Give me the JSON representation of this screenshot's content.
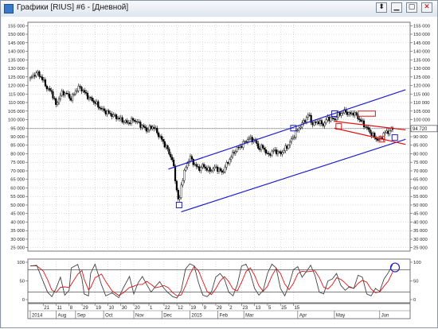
{
  "window": {
    "title": "Графики [RIUS] #6 - [Дневной]"
  },
  "titlebar_buttons": [
    {
      "name": "pin-button",
      "glyph": "⬍"
    },
    {
      "name": "minimize-button",
      "glyph": "▁"
    },
    {
      "name": "maximize-button",
      "glyph": "▢"
    },
    {
      "name": "close-button",
      "glyph": "✕"
    }
  ],
  "colors": {
    "candles": "#000000",
    "channel": "#1f1fcc",
    "channel_red": "#e01414",
    "osc_main": "#444444",
    "osc_signal": "#e01414",
    "grid": "#b8b8b8",
    "marker_blue": "#1f1fcc",
    "marker_red": "#e01414"
  },
  "chart_data": [
    {
      "type": "candlestick",
      "y_ticks": [
        25000,
        30000,
        35000,
        40000,
        45000,
        50000,
        55000,
        60000,
        65000,
        70000,
        75000,
        80000,
        85000,
        90000,
        95000,
        100000,
        105000,
        110000,
        115000,
        120000,
        125000,
        130000,
        135000,
        140000,
        145000,
        150000,
        155000
      ],
      "y_tick_labels": [
        "25 000",
        "30 000",
        "35 000",
        "40 000",
        "45 000",
        "50 000",
        "55 000",
        "60 000",
        "65 000",
        "70 000",
        "75 000",
        "80 000",
        "85 000",
        "90 000",
        "95 000",
        "100 000",
        "105 000",
        "110 000",
        "115 000",
        "120 000",
        "125 000",
        "130 000",
        "135 000",
        "140 000",
        "145 000",
        "150 000",
        "155 000"
      ],
      "ylim": [
        23000,
        157000
      ],
      "last_price_label": "94 720",
      "last_price": 94720,
      "close_path": [
        {
          "t": 0,
          "c": 124000
        },
        {
          "t": 3,
          "c": 127500
        },
        {
          "t": 5,
          "c": 125000
        },
        {
          "t": 8,
          "c": 118000
        },
        {
          "t": 10,
          "c": 116000
        },
        {
          "t": 12,
          "c": 108000
        },
        {
          "t": 13,
          "c": 112000
        },
        {
          "t": 15,
          "c": 116000
        },
        {
          "t": 17,
          "c": 115000
        },
        {
          "t": 19,
          "c": 112000
        },
        {
          "t": 21,
          "c": 117000
        },
        {
          "t": 23,
          "c": 119000
        },
        {
          "t": 25,
          "c": 116000
        },
        {
          "t": 27,
          "c": 113000
        },
        {
          "t": 30,
          "c": 110000
        },
        {
          "t": 33,
          "c": 106000
        },
        {
          "t": 36,
          "c": 104000
        },
        {
          "t": 39,
          "c": 102000
        },
        {
          "t": 42,
          "c": 100000
        },
        {
          "t": 45,
          "c": 98000
        },
        {
          "t": 48,
          "c": 100000
        },
        {
          "t": 51,
          "c": 97000
        },
        {
          "t": 54,
          "c": 94000
        },
        {
          "t": 57,
          "c": 96000
        },
        {
          "t": 60,
          "c": 90000
        },
        {
          "t": 63,
          "c": 84000
        },
        {
          "t": 66,
          "c": 76000
        },
        {
          "t": 68,
          "c": 58000
        },
        {
          "t": 69,
          "c": 50000
        },
        {
          "t": 70,
          "c": 62000
        },
        {
          "t": 72,
          "c": 72000
        },
        {
          "t": 74,
          "c": 78000
        },
        {
          "t": 76,
          "c": 74000
        },
        {
          "t": 78,
          "c": 71000
        },
        {
          "t": 80,
          "c": 73000
        },
        {
          "t": 83,
          "c": 70000
        },
        {
          "t": 86,
          "c": 72000
        },
        {
          "t": 89,
          "c": 69000
        },
        {
          "t": 92,
          "c": 76000
        },
        {
          "t": 95,
          "c": 82000
        },
        {
          "t": 98,
          "c": 85000
        },
        {
          "t": 101,
          "c": 89000
        },
        {
          "t": 104,
          "c": 88000
        },
        {
          "t": 106,
          "c": 83000
        },
        {
          "t": 108,
          "c": 84000
        },
        {
          "t": 110,
          "c": 79000
        },
        {
          "t": 113,
          "c": 82000
        },
        {
          "t": 116,
          "c": 80000
        },
        {
          "t": 119,
          "c": 84000
        },
        {
          "t": 121,
          "c": 88000
        },
        {
          "t": 123,
          "c": 92000
        },
        {
          "t": 125,
          "c": 96000
        },
        {
          "t": 127,
          "c": 99000
        },
        {
          "t": 129,
          "c": 103000
        },
        {
          "t": 131,
          "c": 97000
        },
        {
          "t": 133,
          "c": 99000
        },
        {
          "t": 136,
          "c": 97000
        },
        {
          "t": 138,
          "c": 101000
        },
        {
          "t": 141,
          "c": 100000
        },
        {
          "t": 143,
          "c": 103000
        },
        {
          "t": 146,
          "c": 105000
        },
        {
          "t": 148,
          "c": 103000
        },
        {
          "t": 150,
          "c": 104000
        },
        {
          "t": 152,
          "c": 101000
        },
        {
          "t": 154,
          "c": 98000
        },
        {
          "t": 156,
          "c": 95000
        },
        {
          "t": 158,
          "c": 92000
        },
        {
          "t": 160,
          "c": 89000
        },
        {
          "t": 162,
          "c": 88000
        },
        {
          "t": 164,
          "c": 92000
        },
        {
          "t": 166,
          "c": 93000
        },
        {
          "t": 168,
          "c": 94720
        }
      ],
      "channel_lines": [
        {
          "color": "blue",
          "from": {
            "t": 64,
            "v": 71000
          },
          "to": {
            "t": 174,
            "v": 117500
          }
        },
        {
          "color": "blue",
          "from": {
            "t": 70,
            "v": 46000
          },
          "to": {
            "t": 174,
            "v": 88500
          }
        },
        {
          "color": "red",
          "from": {
            "t": 141,
            "v": 99000
          },
          "to": {
            "t": 174,
            "v": 94000
          }
        },
        {
          "color": "red",
          "from": {
            "t": 141,
            "v": 95000
          },
          "to": {
            "t": 174,
            "v": 85500
          }
        }
      ],
      "markers": [
        {
          "color": "blue",
          "t": 69,
          "v": 50000
        },
        {
          "color": "blue",
          "t": 122,
          "v": 95000
        },
        {
          "color": "blue",
          "t": 141,
          "v": 103500
        },
        {
          "color": "blue",
          "t": 169,
          "v": 89500
        },
        {
          "color": "red",
          "t": 143,
          "v": 96000
        },
        {
          "color": "red",
          "t": 163,
          "v": 88500
        }
      ],
      "red_rect": {
        "t1": 152,
        "t2": 160,
        "v1": 105000,
        "v2": 102000
      }
    },
    {
      "type": "line",
      "name": "oscillator",
      "ylim": [
        0,
        100
      ],
      "y_ticks": [
        0,
        50,
        100
      ],
      "y_tick_labels": [
        "0",
        "50",
        "100"
      ],
      "reference_lines": [
        20,
        80
      ],
      "main": [
        {
          "t": 0,
          "v": 90
        },
        {
          "t": 3,
          "v": 92
        },
        {
          "t": 6,
          "v": 48
        },
        {
          "t": 8,
          "v": 20
        },
        {
          "t": 10,
          "v": 8
        },
        {
          "t": 12,
          "v": 30
        },
        {
          "t": 14,
          "v": 60
        },
        {
          "t": 16,
          "v": 12
        },
        {
          "t": 18,
          "v": 25
        },
        {
          "t": 19,
          "v": 85
        },
        {
          "t": 22,
          "v": 94
        },
        {
          "t": 24,
          "v": 55
        },
        {
          "t": 25,
          "v": 15
        },
        {
          "t": 27,
          "v": 10
        },
        {
          "t": 28,
          "v": 70
        },
        {
          "t": 30,
          "v": 95
        },
        {
          "t": 33,
          "v": 40
        },
        {
          "t": 35,
          "v": 10
        },
        {
          "t": 38,
          "v": 18
        },
        {
          "t": 41,
          "v": 5
        },
        {
          "t": 43,
          "v": 30
        },
        {
          "t": 46,
          "v": 62
        },
        {
          "t": 48,
          "v": 15
        },
        {
          "t": 50,
          "v": 45
        },
        {
          "t": 52,
          "v": 62
        },
        {
          "t": 54,
          "v": 40
        },
        {
          "t": 56,
          "v": 20
        },
        {
          "t": 58,
          "v": 35
        },
        {
          "t": 60,
          "v": 48
        },
        {
          "t": 62,
          "v": 30
        },
        {
          "t": 64,
          "v": 18
        },
        {
          "t": 66,
          "v": 8
        },
        {
          "t": 68,
          "v": 4
        },
        {
          "t": 70,
          "v": 25
        },
        {
          "t": 72,
          "v": 82
        },
        {
          "t": 74,
          "v": 96
        },
        {
          "t": 76,
          "v": 90
        },
        {
          "t": 78,
          "v": 45
        },
        {
          "t": 80,
          "v": 12
        },
        {
          "t": 82,
          "v": 8
        },
        {
          "t": 84,
          "v": 20
        },
        {
          "t": 86,
          "v": 60
        },
        {
          "t": 88,
          "v": 70
        },
        {
          "t": 90,
          "v": 55
        },
        {
          "t": 92,
          "v": 20
        },
        {
          "t": 94,
          "v": 10
        },
        {
          "t": 96,
          "v": 40
        },
        {
          "t": 98,
          "v": 90
        },
        {
          "t": 100,
          "v": 95
        },
        {
          "t": 102,
          "v": 70
        },
        {
          "t": 104,
          "v": 30
        },
        {
          "t": 106,
          "v": 12
        },
        {
          "t": 108,
          "v": 25
        },
        {
          "t": 110,
          "v": 70
        },
        {
          "t": 112,
          "v": 95
        },
        {
          "t": 114,
          "v": 85
        },
        {
          "t": 116,
          "v": 30
        },
        {
          "t": 118,
          "v": 10
        },
        {
          "t": 120,
          "v": 40
        },
        {
          "t": 122,
          "v": 80
        },
        {
          "t": 124,
          "v": 88
        },
        {
          "t": 126,
          "v": 60
        },
        {
          "t": 128,
          "v": 75
        },
        {
          "t": 130,
          "v": 92
        },
        {
          "t": 132,
          "v": 65
        },
        {
          "t": 134,
          "v": 20
        },
        {
          "t": 136,
          "v": 15
        },
        {
          "t": 138,
          "v": 50
        },
        {
          "t": 140,
          "v": 55
        },
        {
          "t": 142,
          "v": 70
        },
        {
          "t": 144,
          "v": 38
        },
        {
          "t": 146,
          "v": 25
        },
        {
          "t": 148,
          "v": 35
        },
        {
          "t": 150,
          "v": 30
        },
        {
          "t": 152,
          "v": 65
        },
        {
          "t": 154,
          "v": 60
        },
        {
          "t": 156,
          "v": 15
        },
        {
          "t": 158,
          "v": 10
        },
        {
          "t": 160,
          "v": 30
        },
        {
          "t": 162,
          "v": 22
        },
        {
          "t": 164,
          "v": 55
        },
        {
          "t": 166,
          "v": 72
        },
        {
          "t": 168,
          "v": 94
        }
      ],
      "circle_marker": {
        "t": 168,
        "v": 86
      }
    }
  ],
  "x_axis": {
    "t_max": 175,
    "day_ticks": [
      {
        "t": 6,
        "label": "21"
      },
      {
        "t": 12,
        "label": "11"
      },
      {
        "t": 18,
        "label": "8"
      },
      {
        "t": 24,
        "label": "29"
      },
      {
        "t": 30,
        "label": "19"
      },
      {
        "t": 36,
        "label": "10"
      },
      {
        "t": 42,
        "label": "30"
      },
      {
        "t": 48,
        "label": "20"
      },
      {
        "t": 55,
        "label": "1"
      },
      {
        "t": 62,
        "label": "22"
      },
      {
        "t": 68,
        "label": "12"
      },
      {
        "t": 74,
        "label": "19"
      },
      {
        "t": 80,
        "label": "9"
      },
      {
        "t": 86,
        "label": "29"
      },
      {
        "t": 92,
        "label": "2"
      },
      {
        "t": 98,
        "label": "23"
      },
      {
        "t": 104,
        "label": "13"
      },
      {
        "t": 110,
        "label": "5"
      },
      {
        "t": 116,
        "label": "25"
      },
      {
        "t": 122,
        "label": "15"
      }
    ],
    "month_labels": [
      {
        "t": 0,
        "label": "2014"
      },
      {
        "t": 12,
        "label": "Aug"
      },
      {
        "t": 21,
        "label": "Sep"
      },
      {
        "t": 34,
        "label": "Oct"
      },
      {
        "t": 48,
        "label": "Nov"
      },
      {
        "t": 61,
        "label": "Dec"
      },
      {
        "t": 74,
        "label": "2015"
      },
      {
        "t": 87,
        "label": "Feb"
      },
      {
        "t": 99,
        "label": "Mar"
      },
      {
        "t": 124,
        "label": "Apr"
      },
      {
        "t": 141,
        "label": "May"
      },
      {
        "t": 162,
        "label": "Jun"
      }
    ]
  }
}
